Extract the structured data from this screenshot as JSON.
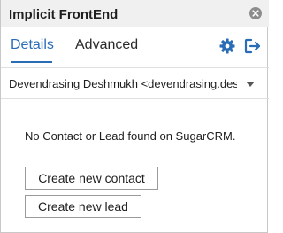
{
  "window": {
    "title": "Implicit FrontEnd"
  },
  "tabs": [
    {
      "label": "Details",
      "active": true
    },
    {
      "label": "Advanced",
      "active": false
    }
  ],
  "toolbar": {
    "settings_icon": "gear-icon",
    "signout_icon": "sign-out-icon"
  },
  "account": {
    "selected": "Devendrasing Deshmukh <devendrasing.deshm"
  },
  "main": {
    "status_message": "No Contact or Lead found on SugarCRM.",
    "create_contact_label": "Create new contact",
    "create_lead_label": "Create new lead"
  },
  "colors": {
    "accent": "#2a6db6",
    "titlebar": "#f0f0f0"
  }
}
